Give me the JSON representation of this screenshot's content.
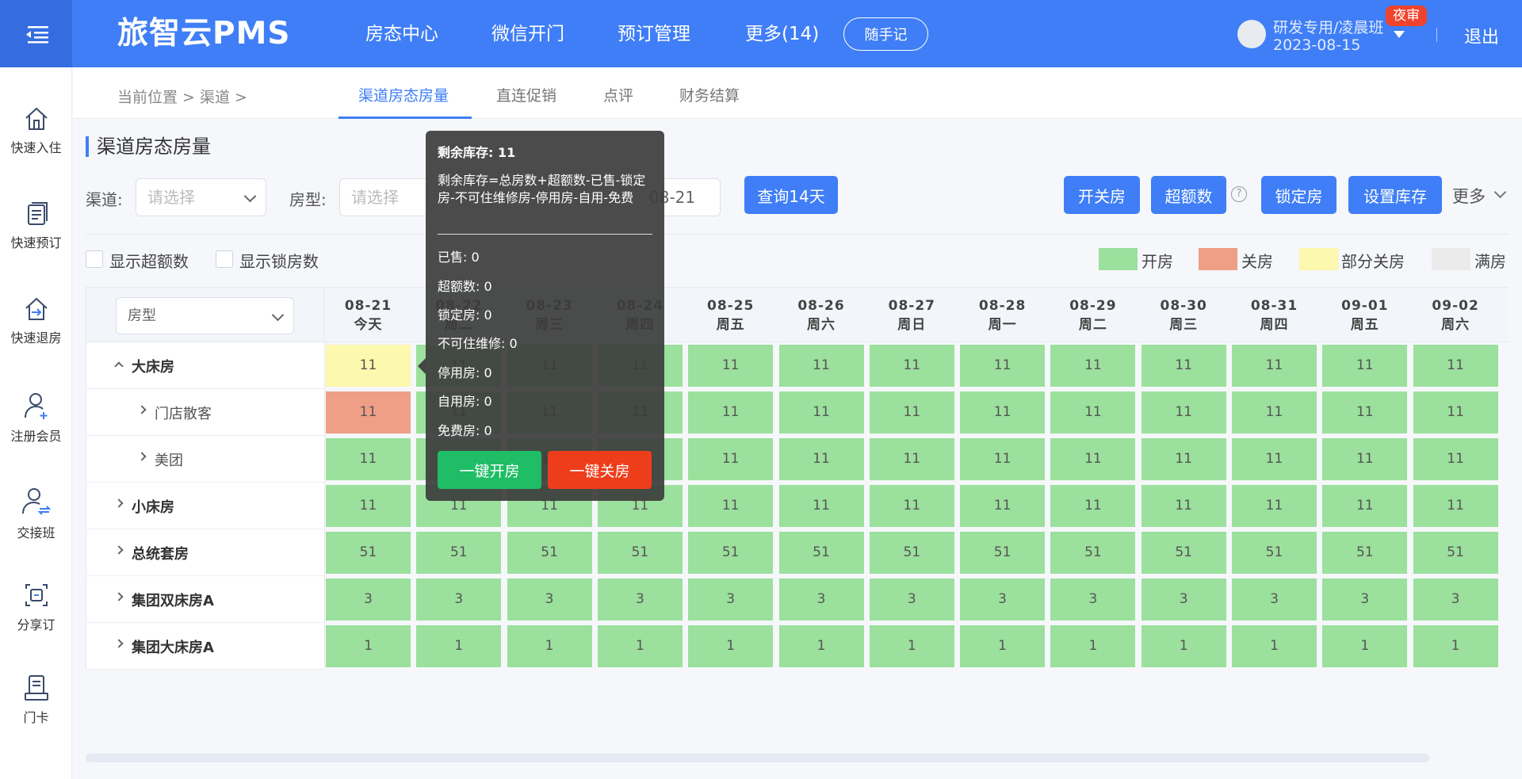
{
  "app": {
    "logo": "旅智云PMS"
  },
  "top_nav": {
    "items": [
      "房态中心",
      "微信开门",
      "预订管理",
      "更多(14)"
    ],
    "notes_button": "随手记",
    "user": {
      "name": "研发专用/凌晨班",
      "date": "2023-08-15",
      "badge": "夜审"
    },
    "logout": "退出"
  },
  "sidebar": {
    "items": [
      {
        "label": "快速入住",
        "icon": "home-icon"
      },
      {
        "label": "快速预订",
        "icon": "document-icon"
      },
      {
        "label": "快速退房",
        "icon": "checkout-icon"
      },
      {
        "label": "注册会员",
        "icon": "add-user-icon"
      },
      {
        "label": "交接班",
        "icon": "handover-icon"
      },
      {
        "label": "分享订",
        "icon": "share-icon"
      },
      {
        "label": "门卡",
        "icon": "card-icon"
      }
    ]
  },
  "breadcrumb": {
    "text": "当前位置 > 渠道 >"
  },
  "sub_tabs": [
    "渠道房态房量",
    "直连促销",
    "点评",
    "财务结算"
  ],
  "page_title": "渠道房态房量",
  "filters": {
    "channel_label": "渠道:",
    "channel_placeholder": "请选择",
    "roomtype_label": "房型:",
    "roomtype_placeholder": "请选择",
    "date_partial": "08-21",
    "query_button": "查询14天"
  },
  "actions": [
    "开关房",
    "超额数",
    "锁定房",
    "设置库存"
  ],
  "help_icon": "?",
  "more": "更多",
  "checkboxes": [
    "显示超额数",
    "显示锁房数"
  ],
  "legend": [
    {
      "label": "开房",
      "color": "#9be09d"
    },
    {
      "label": "关房",
      "color": "#ee9f86"
    },
    {
      "label": "部分关房",
      "color": "#fcf8ad"
    },
    {
      "label": "满房",
      "color": "#ebebeb"
    }
  ],
  "grid": {
    "roomtype_select": "房型",
    "dates": [
      {
        "date": "08-21",
        "day": "今天"
      },
      {
        "date": "08-22",
        "day": "周二"
      },
      {
        "date": "08-23",
        "day": "周三"
      },
      {
        "date": "08-24",
        "day": "周四"
      },
      {
        "date": "08-25",
        "day": "周五"
      },
      {
        "date": "08-26",
        "day": "周六"
      },
      {
        "date": "08-27",
        "day": "周日"
      },
      {
        "date": "08-28",
        "day": "周一"
      },
      {
        "date": "08-29",
        "day": "周二"
      },
      {
        "date": "08-30",
        "day": "周三"
      },
      {
        "date": "08-31",
        "day": "周四"
      },
      {
        "date": "09-01",
        "day": "周五"
      },
      {
        "date": "09-02",
        "day": "周六"
      }
    ],
    "rows": [
      {
        "name": "大床房",
        "level": 0,
        "expanded": true,
        "values": [
          "11",
          "11",
          "11",
          "11",
          "11",
          "11",
          "11",
          "11",
          "11",
          "11",
          "11",
          "11",
          "11"
        ],
        "first_state": "partial"
      },
      {
        "name": "门店散客",
        "level": 1,
        "values": [
          "11",
          "11",
          "11",
          "11",
          "11",
          "11",
          "11",
          "11",
          "11",
          "11",
          "11",
          "11",
          "11"
        ],
        "first_state": "closed"
      },
      {
        "name": "美团",
        "level": 1,
        "values": [
          "11",
          "11",
          "11",
          "11",
          "11",
          "11",
          "11",
          "11",
          "11",
          "11",
          "11",
          "11",
          "11"
        ],
        "first_state": "open"
      },
      {
        "name": "小床房",
        "level": 0,
        "values": [
          "11",
          "11",
          "11",
          "11",
          "11",
          "11",
          "11",
          "11",
          "11",
          "11",
          "11",
          "11",
          "11"
        ],
        "first_state": "open"
      },
      {
        "name": "总统套房",
        "level": 0,
        "values": [
          "51",
          "51",
          "51",
          "51",
          "51",
          "51",
          "51",
          "51",
          "51",
          "51",
          "51",
          "51",
          "51"
        ],
        "first_state": "open"
      },
      {
        "name": "集团双床房A",
        "level": 0,
        "values": [
          "3",
          "3",
          "3",
          "3",
          "3",
          "3",
          "3",
          "3",
          "3",
          "3",
          "3",
          "3",
          "3"
        ],
        "first_state": "open"
      },
      {
        "name": "集团大床房A",
        "level": 0,
        "values": [
          "1",
          "1",
          "1",
          "1",
          "1",
          "1",
          "1",
          "1",
          "1",
          "1",
          "1",
          "1",
          "1"
        ],
        "first_state": "open"
      }
    ]
  },
  "tooltip": {
    "remaining": "剩余库存: 11",
    "formula": "剩余库存=总房数+超额数-已售-锁定房-不可住维修房-停用房-自用-免费",
    "stats": [
      "已售: 0",
      "超额数: 0",
      "锁定房: 0",
      "不可住维修: 0",
      "停用房: 0",
      "自用房: 0",
      "免费房: 0"
    ],
    "open_button": "一键开房",
    "close_button": "一键关房"
  }
}
